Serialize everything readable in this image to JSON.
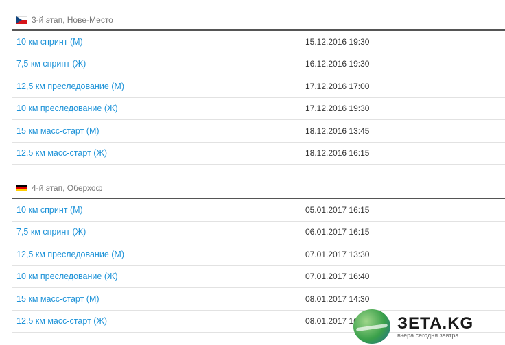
{
  "stages": [
    {
      "title": "3-й этап, Нове-Место",
      "flag": "cz-flag-icon",
      "events": [
        {
          "name": "10 км спринт (М)",
          "date": "15.12.2016 19:30"
        },
        {
          "name": "7,5 км спринт (Ж)",
          "date": "16.12.2016 19:30"
        },
        {
          "name": "12,5 км преследование (М)",
          "date": "17.12.2016 17:00"
        },
        {
          "name": "10 км преследование (Ж)",
          "date": "17.12.2016 19:30"
        },
        {
          "name": "15 км масс-старт (М)",
          "date": "18.12.2016 13:45"
        },
        {
          "name": "12,5 км масс-старт (Ж)",
          "date": "18.12.2016 16:15"
        }
      ]
    },
    {
      "title": "4-й этап, Оберхоф",
      "flag": "de-flag-icon",
      "events": [
        {
          "name": "10 км спринт (М)",
          "date": "05.01.2017 16:15"
        },
        {
          "name": "7,5 км спринт (Ж)",
          "date": "06.01.2017 16:15"
        },
        {
          "name": "12,5 км преследование (М)",
          "date": "07.01.2017 13:30"
        },
        {
          "name": "10 км преследование (Ж)",
          "date": "07.01.2017 16:40"
        },
        {
          "name": "15 км масс-старт (М)",
          "date": "08.01.2017 14:30"
        },
        {
          "name": "12,5 км масс-старт (Ж)",
          "date": "08.01.2017 16:15"
        }
      ]
    }
  ],
  "watermark": {
    "brand": "ЗЕТА.KG",
    "tagline": "вчера сегодня завтра"
  },
  "colors": {
    "link": "#1f93d8",
    "header_border": "#555555",
    "row_border": "#e2e2e2"
  }
}
